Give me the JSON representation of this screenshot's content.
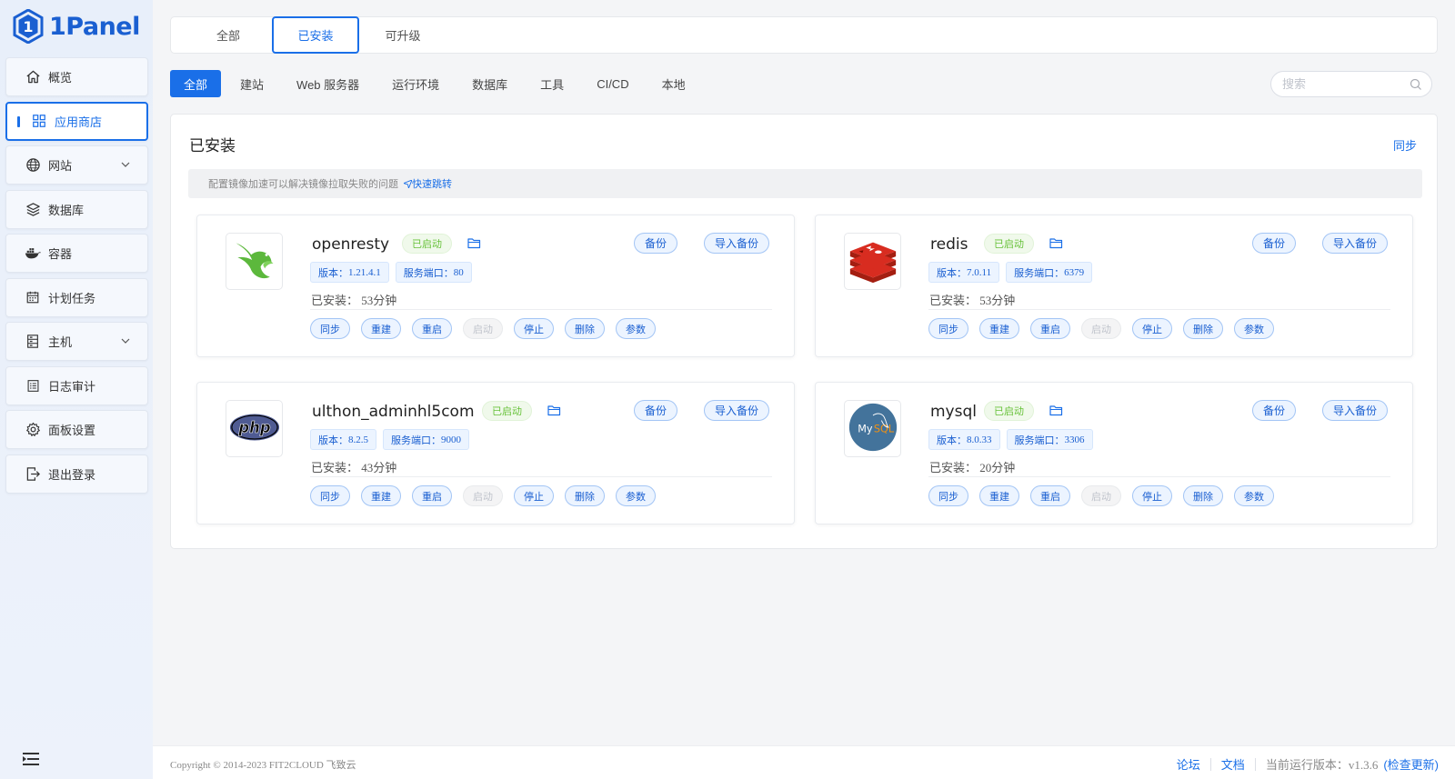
{
  "app": {
    "logo_text": "1Panel"
  },
  "sidebar": {
    "items": [
      {
        "label": "概览",
        "icon": "home-icon",
        "active": false,
        "expandable": false
      },
      {
        "label": "应用商店",
        "icon": "apps-grid-icon",
        "active": true,
        "expandable": false
      },
      {
        "label": "网站",
        "icon": "globe-icon",
        "active": false,
        "expandable": true
      },
      {
        "label": "数据库",
        "icon": "layers-icon",
        "active": false,
        "expandable": false
      },
      {
        "label": "容器",
        "icon": "docker-icon",
        "active": false,
        "expandable": false
      },
      {
        "label": "计划任务",
        "icon": "calendar-icon",
        "active": false,
        "expandable": false
      },
      {
        "label": "主机",
        "icon": "server-icon",
        "active": false,
        "expandable": true
      },
      {
        "label": "日志审计",
        "icon": "log-icon",
        "active": false,
        "expandable": false
      },
      {
        "label": "面板设置",
        "icon": "gear-icon",
        "active": false,
        "expandable": false
      },
      {
        "label": "退出登录",
        "icon": "logout-icon",
        "active": false,
        "expandable": false
      }
    ]
  },
  "top_tabs": [
    {
      "label": "全部",
      "active": false
    },
    {
      "label": "已安装",
      "active": true
    },
    {
      "label": "可升级",
      "active": false
    }
  ],
  "categories": [
    {
      "label": "全部",
      "active": true
    },
    {
      "label": "建站",
      "active": false
    },
    {
      "label": "Web 服务器",
      "active": false
    },
    {
      "label": "运行环境",
      "active": false
    },
    {
      "label": "数据库",
      "active": false
    },
    {
      "label": "工具",
      "active": false
    },
    {
      "label": "CI/CD",
      "active": false
    },
    {
      "label": "本地",
      "active": false
    }
  ],
  "search": {
    "placeholder": "搜索",
    "value": ""
  },
  "panel": {
    "title": "已安装",
    "sync_label": "同步",
    "notice": "配置镜像加速可以解决镜像拉取失败的问题",
    "notice_link": "快速跳转"
  },
  "card_labels": {
    "backup": "备份",
    "import_backup": "导入备份",
    "installed_prefix": "已安装：",
    "version_prefix": "版本：",
    "port_prefix": "服务端口："
  },
  "apps": [
    {
      "name": "openresty",
      "status": "已启动",
      "version": "1.21.4.1",
      "port": "80",
      "installed": "53分钟",
      "logo": "openresty-logo",
      "actions": [
        {
          "label": "同步",
          "enabled": true
        },
        {
          "label": "重建",
          "enabled": true
        },
        {
          "label": "重启",
          "enabled": true
        },
        {
          "label": "启动",
          "enabled": false
        },
        {
          "label": "停止",
          "enabled": true
        },
        {
          "label": "删除",
          "enabled": true
        },
        {
          "label": "参数",
          "enabled": true
        }
      ]
    },
    {
      "name": "redis",
      "status": "已启动",
      "version": "7.0.11",
      "port": "6379",
      "installed": "53分钟",
      "logo": "redis-logo",
      "actions": [
        {
          "label": "同步",
          "enabled": true
        },
        {
          "label": "重建",
          "enabled": true
        },
        {
          "label": "重启",
          "enabled": true
        },
        {
          "label": "启动",
          "enabled": false
        },
        {
          "label": "停止",
          "enabled": true
        },
        {
          "label": "删除",
          "enabled": true
        },
        {
          "label": "参数",
          "enabled": true
        }
      ]
    },
    {
      "name": "ulthon_adminhl5com",
      "status": "已启动",
      "version": "8.2.5",
      "port": "9000",
      "installed": "43分钟",
      "logo": "php-logo",
      "actions": [
        {
          "label": "同步",
          "enabled": true
        },
        {
          "label": "重建",
          "enabled": true
        },
        {
          "label": "重启",
          "enabled": true
        },
        {
          "label": "启动",
          "enabled": false
        },
        {
          "label": "停止",
          "enabled": true
        },
        {
          "label": "删除",
          "enabled": true
        },
        {
          "label": "参数",
          "enabled": true
        }
      ]
    },
    {
      "name": "mysql",
      "status": "已启动",
      "version": "8.0.33",
      "port": "3306",
      "installed": "20分钟",
      "logo": "mysql-logo",
      "actions": [
        {
          "label": "同步",
          "enabled": true
        },
        {
          "label": "重建",
          "enabled": true
        },
        {
          "label": "重启",
          "enabled": true
        },
        {
          "label": "启动",
          "enabled": false
        },
        {
          "label": "停止",
          "enabled": true
        },
        {
          "label": "删除",
          "enabled": true
        },
        {
          "label": "参数",
          "enabled": true
        }
      ]
    }
  ],
  "footer": {
    "copyright": "Copyright © 2014-2023 FIT2CLOUD 飞致云",
    "forum": "论坛",
    "docs": "文档",
    "version_text": "当前运行版本：v1.3.6",
    "check_update": "(检查更新)"
  },
  "colors": {
    "accent": "#1a6fe8",
    "running_green": "#67c23a",
    "sidebar_bg": "#e8effa"
  }
}
